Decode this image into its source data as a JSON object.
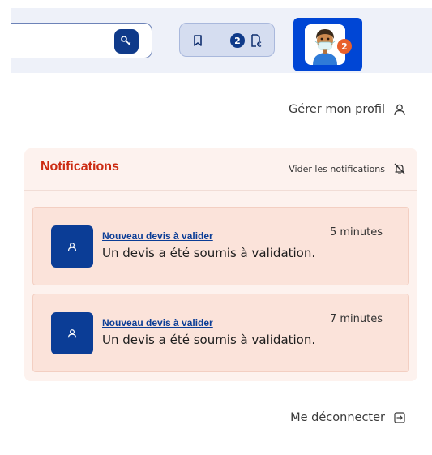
{
  "colors": {
    "header_bg": "#eef1f9",
    "primary_blue": "#0f3a8a",
    "avatar_tile_blue": "#0046d5",
    "badge_orange": "#e8602c",
    "notif_title_red": "#cc2b12",
    "notif_panel_bg": "#fdf2ee",
    "notif_card_bg": "#fbe3da"
  },
  "header": {
    "search": {
      "icon": "key-icon"
    },
    "toolbar": {
      "bookmark_icon": "bookmark-icon",
      "quote_count": "2",
      "quote_icon": "euro-document-icon"
    },
    "avatar": {
      "notification_count": "2"
    }
  },
  "menu": {
    "profile_label": "Gérer mon profil",
    "profile_icon": "user-icon",
    "logout_label": "Me déconnecter",
    "logout_icon": "logout-icon"
  },
  "notifications": {
    "title": "Notifications",
    "clear_label": "Vider les notifications",
    "clear_icon": "bell-off-icon",
    "items": [
      {
        "icon": "user-icon",
        "title": "Nouveau devis à valider",
        "time": "5 minutes",
        "message": "Un devis a été soumis à validation."
      },
      {
        "icon": "user-icon",
        "title": "Nouveau devis à valider",
        "time": "7 minutes",
        "message": "Un devis a été soumis à validation."
      }
    ]
  }
}
